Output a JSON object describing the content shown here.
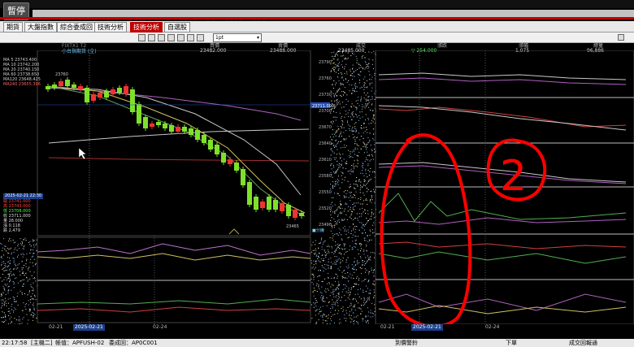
{
  "overlay": {
    "pause_label": "暫停"
  },
  "menu": {
    "items": [
      "■■■■",
      "■■",
      "■■■■",
      "■■■",
      "■■■■",
      "■■■",
      "■■■■",
      "■■",
      "■■■■",
      "■■■"
    ]
  },
  "tabs": [
    {
      "label": "期貨",
      "active": false
    },
    {
      "label": "大盤指數",
      "active": false
    },
    {
      "label": "綜合委成回",
      "active": false
    },
    {
      "label": "技術分析",
      "active": false
    },
    {
      "label": "技術分析",
      "active": true
    },
    {
      "label": "自選股",
      "active": false
    }
  ],
  "toolbar": {
    "zoom_value": "1pt"
  },
  "header": {
    "title": "小台指期貨 (全)",
    "code": "FIXTX1 T2",
    "columns": [
      {
        "label": "買價",
        "value": "23482.000"
      },
      {
        "label": "賣價",
        "value": "23488.000"
      },
      {
        "label": "成交",
        "value": "23485.000"
      },
      {
        "label": "漲跌",
        "value": "▽ 254.000"
      },
      {
        "label": "漲幅",
        "value": "1.075"
      },
      {
        "label": "總量",
        "value": "96,886"
      }
    ]
  },
  "legend": [
    {
      "text": "MA  5   23743.400",
      "color": "#cfcfcf"
    },
    {
      "text": "MA 10   23742.200",
      "color": "#cfcfcf"
    },
    {
      "text": "MA 20   23740.150",
      "color": "#cfcfcf"
    },
    {
      "text": "MA 60   23738.650",
      "color": "#cfcfcf"
    },
    {
      "text": "MA120   23648.425",
      "color": "#cfcfcf"
    },
    {
      "text": "MA240   23655.396",
      "color": "#ff6060"
    }
  ],
  "quote": {
    "date": "2025-02-21 22:30",
    "rows": [
      {
        "label": "開",
        "value": "23741.000",
        "color": "#ff4444"
      },
      {
        "label": "高",
        "value": "23743.000",
        "color": "#ff4444"
      },
      {
        "label": "低",
        "value": "23708.000",
        "color": "#44ff44"
      },
      {
        "label": "收",
        "value": "23711.000",
        "color": "#dddddd"
      },
      {
        "label": "量",
        "value": "28.000",
        "color": "#dddddd"
      },
      {
        "label": "漲",
        "value": "0.118",
        "color": "#dddddd"
      },
      {
        "label": "跌",
        "value": "2,479",
        "color": "#dddddd"
      }
    ]
  },
  "price_axis": {
    "ticks": [
      "23790",
      "23760",
      "23730",
      "23700",
      "23670",
      "23640",
      "23610",
      "23580",
      "23550",
      "23520",
      "23490"
    ],
    "current": "23711.000",
    "high_label": "23760",
    "low_label": "23465",
    "unit_label": "■分鐘"
  },
  "x_axis": {
    "left": [
      {
        "label": "02-21",
        "hl": false
      },
      {
        "label": "2025-02-21",
        "hl": true
      },
      {
        "label": "02-24",
        "hl": false
      }
    ],
    "right": [
      {
        "label": "02-21",
        "hl": false
      },
      {
        "label": "2025-02-21",
        "hl": true
      },
      {
        "label": "02-24",
        "hl": false
      }
    ]
  },
  "status": {
    "time": "22:17:58",
    "account": "[主機二]",
    "order_label": "帳值：APFUSH-02",
    "order_id": "委成回：AP0C001",
    "mid_label": "到價警鈴",
    "right_a": "下單",
    "right_b": "成交回報通"
  },
  "annotation": {
    "circled_digit": "2",
    "color": "#ff0000"
  },
  "colors": {
    "up": "#e33",
    "down": "#7fe02a",
    "accent": "#c00000"
  }
}
